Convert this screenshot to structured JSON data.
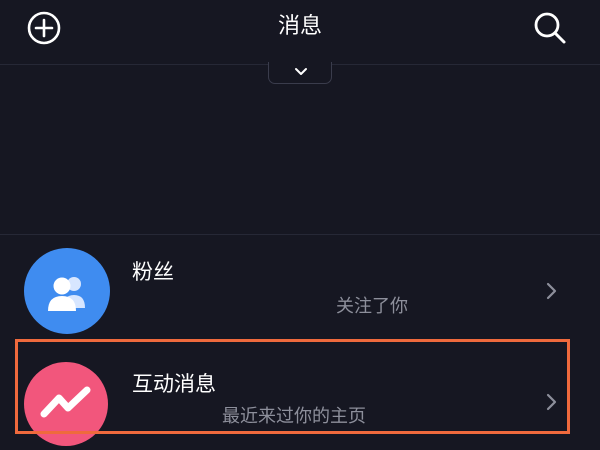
{
  "header": {
    "title": "消息",
    "add_icon": "plus-circle-icon",
    "search_icon": "search-icon"
  },
  "expand_handle_icon": "chevron-down-icon",
  "list": [
    {
      "title": "粉丝",
      "subtitle": "关注了你",
      "icon": "people-icon",
      "color": "#3f8cf0"
    },
    {
      "title": "互动消息",
      "subtitle": "最近来过你的主页",
      "icon": "wave-icon",
      "color": "#f2567c"
    }
  ],
  "colors": {
    "background": "#161722",
    "highlight": "#ef6a3d"
  }
}
